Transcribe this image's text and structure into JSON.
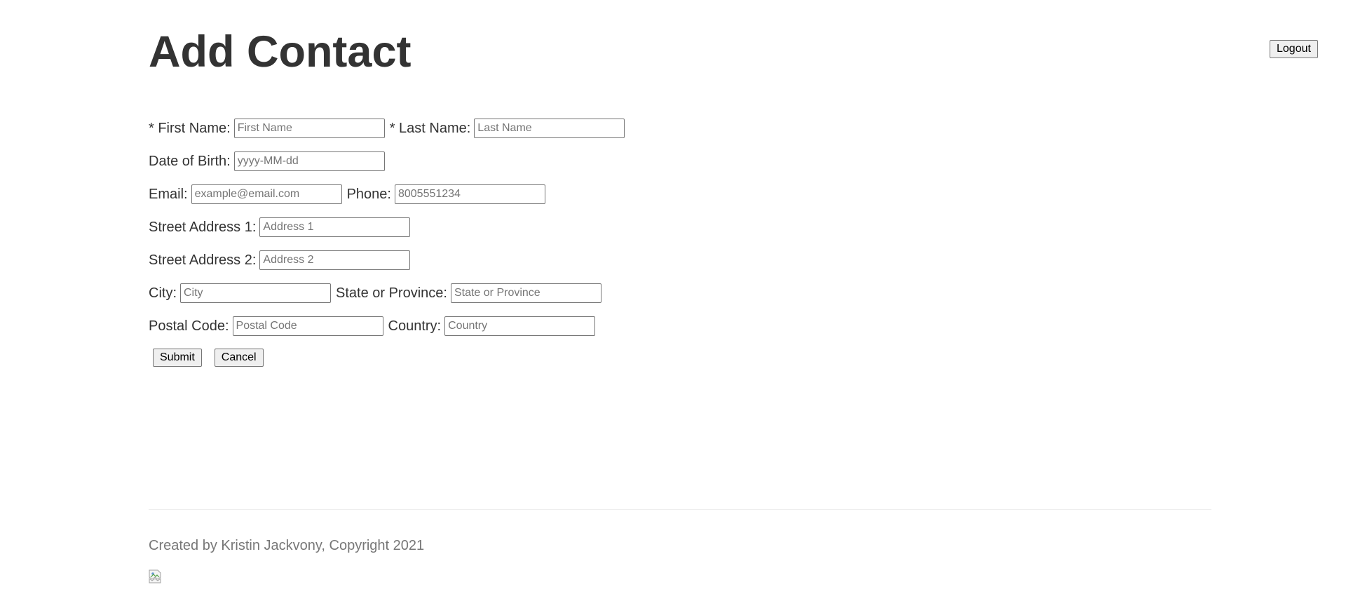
{
  "header": {
    "title": "Add Contact",
    "logout_label": "Logout"
  },
  "form": {
    "first_name": {
      "label": "* First Name:",
      "placeholder": "First Name"
    },
    "last_name": {
      "label": "* Last Name:",
      "placeholder": "Last Name"
    },
    "dob": {
      "label": "Date of Birth:",
      "placeholder": "yyyy-MM-dd"
    },
    "email": {
      "label": "Email:",
      "placeholder": "example@email.com"
    },
    "phone": {
      "label": "Phone:",
      "placeholder": "8005551234"
    },
    "street1": {
      "label": "Street Address 1:",
      "placeholder": "Address 1"
    },
    "street2": {
      "label": "Street Address 2:",
      "placeholder": "Address 2"
    },
    "city": {
      "label": "City:",
      "placeholder": "City"
    },
    "state": {
      "label": "State or Province:",
      "placeholder": "State or Province"
    },
    "postal": {
      "label": "Postal Code:",
      "placeholder": "Postal Code"
    },
    "country": {
      "label": "Country:",
      "placeholder": "Country"
    },
    "submit_label": "Submit",
    "cancel_label": "Cancel"
  },
  "footer": {
    "text": "Created by Kristin Jackvony, Copyright 2021",
    "image_icon": "broken-image-icon"
  }
}
